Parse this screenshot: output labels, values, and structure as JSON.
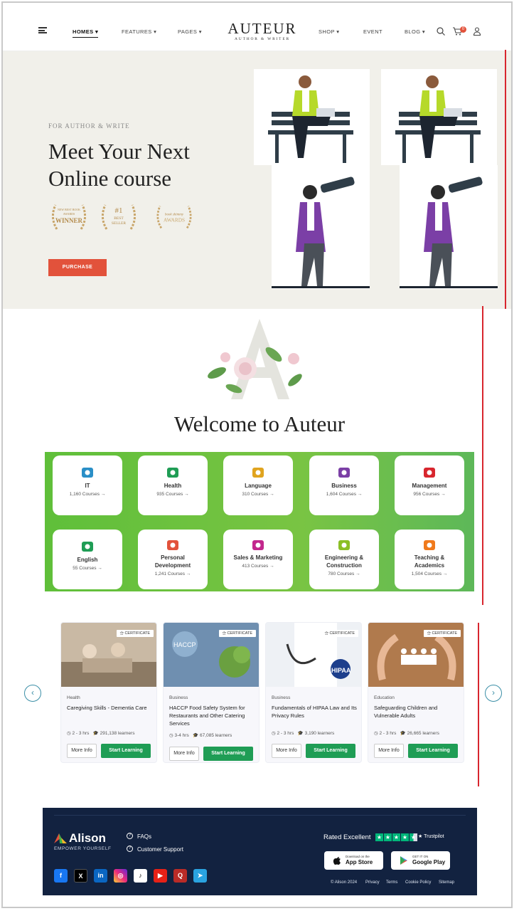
{
  "nav": {
    "items": [
      {
        "label": "HOMES ▾",
        "name": "nav-homes"
      },
      {
        "label": "FEATURES ▾",
        "name": "nav-features"
      },
      {
        "label": "PAGES ▾",
        "name": "nav-pages"
      },
      {
        "label": "SHOP ▾",
        "name": "nav-shop"
      },
      {
        "label": "EVENT",
        "name": "nav-event"
      },
      {
        "label": "BLOG ▾",
        "name": "nav-blog"
      }
    ],
    "logo_title": "AUTEUR",
    "logo_subtitle": "AUTHOR & WRITER",
    "cart_count": "0"
  },
  "hero": {
    "eyebrow": "FOR AUTHOR & WRITE",
    "title_line1": "Meet Your Next",
    "title_line2": "Online course",
    "awards": [
      {
        "line1": "NEW BEST BOOK",
        "line2": "AWARDS",
        "line3": "WINNER"
      },
      {
        "line1": "#1",
        "line2": "BEST",
        "line3": "SELLER"
      },
      {
        "line1": "book shimmy",
        "line2": "AWARDS",
        "line3": ""
      }
    ],
    "purchase_label": "PURCHASE"
  },
  "welcome_title": "Welcome to Auteur",
  "categories": [
    {
      "name": "IT",
      "count": "1,160 Courses →",
      "color": "#2a8fc7"
    },
    {
      "name": "Health",
      "count": "935 Courses →",
      "color": "#1f9d55"
    },
    {
      "name": "Language",
      "count": "310 Courses →",
      "color": "#e0a41f"
    },
    {
      "name": "Business",
      "count": "1,604 Courses →",
      "color": "#7b3fa6"
    },
    {
      "name": "Management",
      "count": "956 Courses →",
      "color": "#d8262e"
    },
    {
      "name": "English",
      "count": "55 Courses →",
      "color": "#1f9d55"
    },
    {
      "name": "Personal Development",
      "count": "1,241 Courses →",
      "color": "#e2523b"
    },
    {
      "name": "Sales & Marketing",
      "count": "413 Courses →",
      "color": "#c2278d"
    },
    {
      "name": "Engineering & Construction",
      "count": "780 Courses →",
      "color": "#8bbf26"
    },
    {
      "name": "Teaching & Academics",
      "count": "1,504 Courses →",
      "color": "#f07a1c"
    }
  ],
  "courses": [
    {
      "category": "Health",
      "title": "Caregiving Skills - Dementia Care",
      "duration": "2 - 3 hrs",
      "learners": "291,138 learners",
      "badge": "CERTIFICATE"
    },
    {
      "category": "Business",
      "title": "HACCP Food Safety System for Restaurants and Other Catering Services",
      "duration": "3-4 hrs",
      "learners": "67,085 learners",
      "badge": "CERTIFICATE"
    },
    {
      "category": "Business",
      "title": "Fundamentals of HIPAA Law and Its Privacy Rules",
      "duration": "2 - 3 hrs",
      "learners": "3,190 learners",
      "badge": "CERTIFICATE"
    },
    {
      "category": "Education",
      "title": "Safeguarding Children and Vulnerable Adults",
      "duration": "2 - 3 hrs",
      "learners": "26,665 learners",
      "badge": "CERTIFICATE"
    }
  ],
  "course_buttons": {
    "more": "More Info",
    "start": "Start Learning"
  },
  "footer": {
    "brand": "Alison",
    "tagline": "EMPOWER YOURSELF",
    "links": [
      "FAQs",
      "Customer Support"
    ],
    "rated": "Rated Excellent",
    "trustpilot": "★ Trustpilot",
    "app_store_small": "Download on the",
    "app_store": "App Store",
    "google_small": "GET IT ON",
    "google": "Google Play",
    "legal": [
      "© Alison 2024",
      "Privacy",
      "Terms",
      "Cookie Policy",
      "Sitemap"
    ]
  }
}
